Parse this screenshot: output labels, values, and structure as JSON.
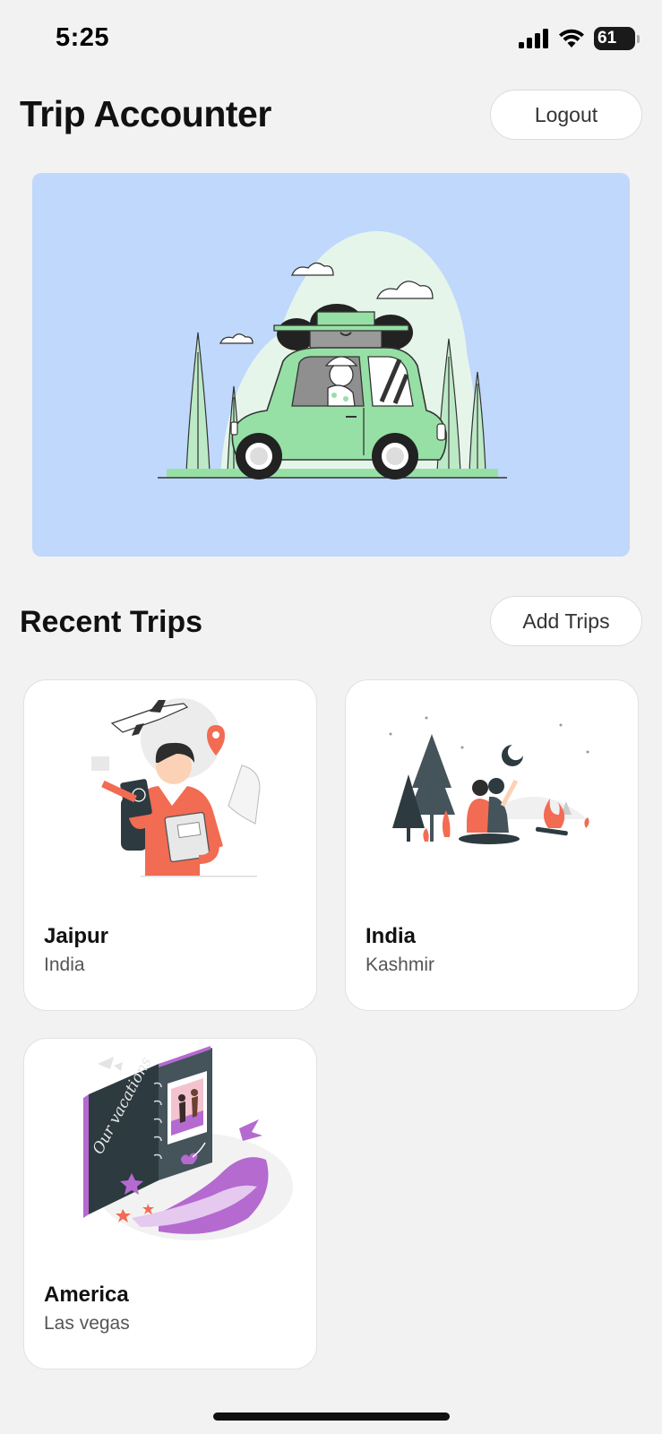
{
  "status_bar": {
    "time": "5:25",
    "battery_level": "61"
  },
  "header": {
    "title": "Trip Accounter",
    "logout_label": "Logout"
  },
  "banner": {
    "illustration": "car-road-trip-illustration"
  },
  "recent_trips": {
    "title": "Recent Trips",
    "add_label": "Add Trips",
    "trips": [
      {
        "title": "Jaipur",
        "subtitle": "India",
        "illustration": "traveler-passport-illustration"
      },
      {
        "title": "India",
        "subtitle": "Kashmir",
        "illustration": "campfire-couple-illustration"
      },
      {
        "title": "America",
        "subtitle": "Las vegas",
        "illustration": "vacation-album-illustration"
      }
    ]
  },
  "album_text": "Our vacations",
  "colors": {
    "background": "#f2f2f2",
    "banner": "#bfd8fb",
    "car": "#96e0a6",
    "accent_orange": "#f26b53",
    "accent_purple": "#b56ad0"
  }
}
